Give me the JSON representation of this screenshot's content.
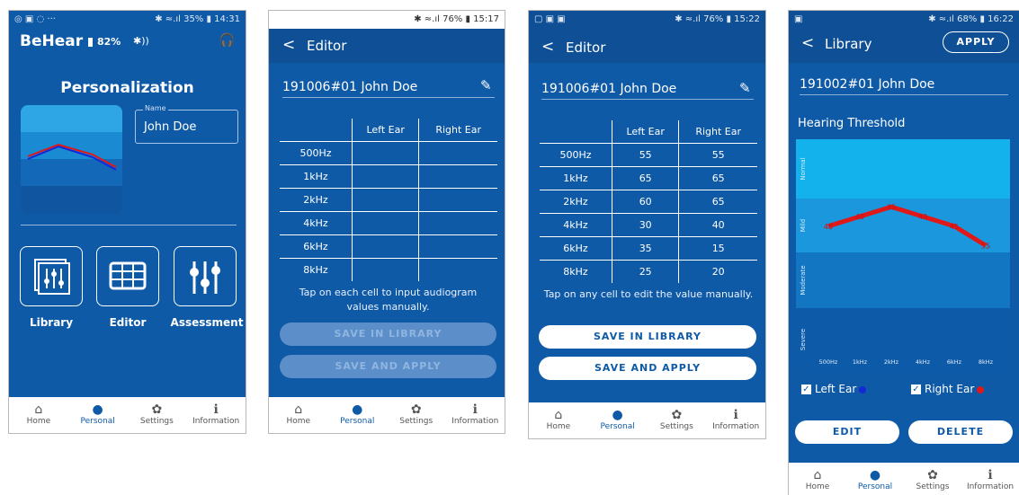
{
  "nav": [
    {
      "icon": "home-icon",
      "glyph": "⌂",
      "label": "Home"
    },
    {
      "icon": "person-icon",
      "glyph": "●",
      "label": "Personal"
    },
    {
      "icon": "gear-icon",
      "glyph": "✿",
      "label": "Settings"
    },
    {
      "icon": "info-icon",
      "glyph": "ℹ",
      "label": "Information"
    }
  ],
  "screen1": {
    "status_left": "◎ ▣ ◌ ···",
    "status_right": "✱ ≈.ıl 35% ▮ 14:31",
    "app_title": "BeHear",
    "battery": "82%",
    "bluetooth": "✱))",
    "headphone": "🎧",
    "page_title": "Personalization",
    "name_label": "Name",
    "name_value": "John Doe",
    "tiles": [
      {
        "icon": "library-icon",
        "label": "Library"
      },
      {
        "icon": "editor-grid-icon",
        "label": "Editor"
      },
      {
        "icon": "sliders-icon",
        "label": "Assessment"
      }
    ]
  },
  "screen2": {
    "status_right": "✱ ≈.ıl 76% ▮ 15:17",
    "back": "<",
    "title": "Editor",
    "profile": "191006#01 John Doe",
    "col_left": "Left Ear",
    "col_right": "Right Ear",
    "rows": [
      {
        "f": "500Hz",
        "l": "",
        "r": ""
      },
      {
        "f": "1kHz",
        "l": "",
        "r": ""
      },
      {
        "f": "2kHz",
        "l": "",
        "r": ""
      },
      {
        "f": "4kHz",
        "l": "",
        "r": ""
      },
      {
        "f": "6kHz",
        "l": "",
        "r": ""
      },
      {
        "f": "8kHz",
        "l": "",
        "r": ""
      }
    ],
    "hint": "Tap on each cell to input audiogram values manually.",
    "save_library": "SAVE IN LIBRARY",
    "save_apply": "SAVE AND APPLY"
  },
  "screen3": {
    "status_left": "▢ ▣ ▣",
    "status_right": "✱ ≈.ıl 76% ▮ 15:22",
    "back": "<",
    "title": "Editor",
    "profile": "191006#01 John Doe",
    "col_left": "Left Ear",
    "col_right": "Right Ear",
    "rows": [
      {
        "f": "500Hz",
        "l": "55",
        "r": "55"
      },
      {
        "f": "1kHz",
        "l": "65",
        "r": "65"
      },
      {
        "f": "2kHz",
        "l": "60",
        "r": "65"
      },
      {
        "f": "4kHz",
        "l": "30",
        "r": "40"
      },
      {
        "f": "6kHz",
        "l": "35",
        "r": "15"
      },
      {
        "f": "8kHz",
        "l": "25",
        "r": "20"
      }
    ],
    "hint": "Tap on any cell to edit the value manually.",
    "save_library": "SAVE IN LIBRARY",
    "save_apply": "SAVE AND APPLY"
  },
  "screen4": {
    "status_left": "▣",
    "status_right": "✱ ≈.ıl 68% ▮ 16:22",
    "back": "<",
    "title": "Library",
    "apply": "APPLY",
    "profile": "191002#01 John Doe",
    "section": "Hearing Threshold",
    "bands": [
      "Normal",
      "Mild",
      "Moderate",
      "Severe"
    ],
    "freqs": [
      "500Hz",
      "1kHz",
      "2kHz",
      "4kHz",
      "6kHz",
      "8kHz"
    ],
    "left_ear_label": "Left Ear",
    "right_ear_label": "Right Ear",
    "left_color": "#1428d8",
    "right_color": "#e01818",
    "edit": "EDIT",
    "delete": "DELETE"
  },
  "chart_data": {
    "type": "line",
    "categories": [
      "500Hz",
      "1kHz",
      "2kHz",
      "4kHz",
      "6kHz",
      "8kHz"
    ],
    "series": [
      {
        "name": "Right Ear",
        "values": [
          45,
          40,
          35,
          40,
          45,
          55
        ]
      }
    ],
    "band_labels": [
      "Normal",
      "Mild",
      "Moderate",
      "Severe"
    ],
    "title": "Hearing Threshold"
  }
}
